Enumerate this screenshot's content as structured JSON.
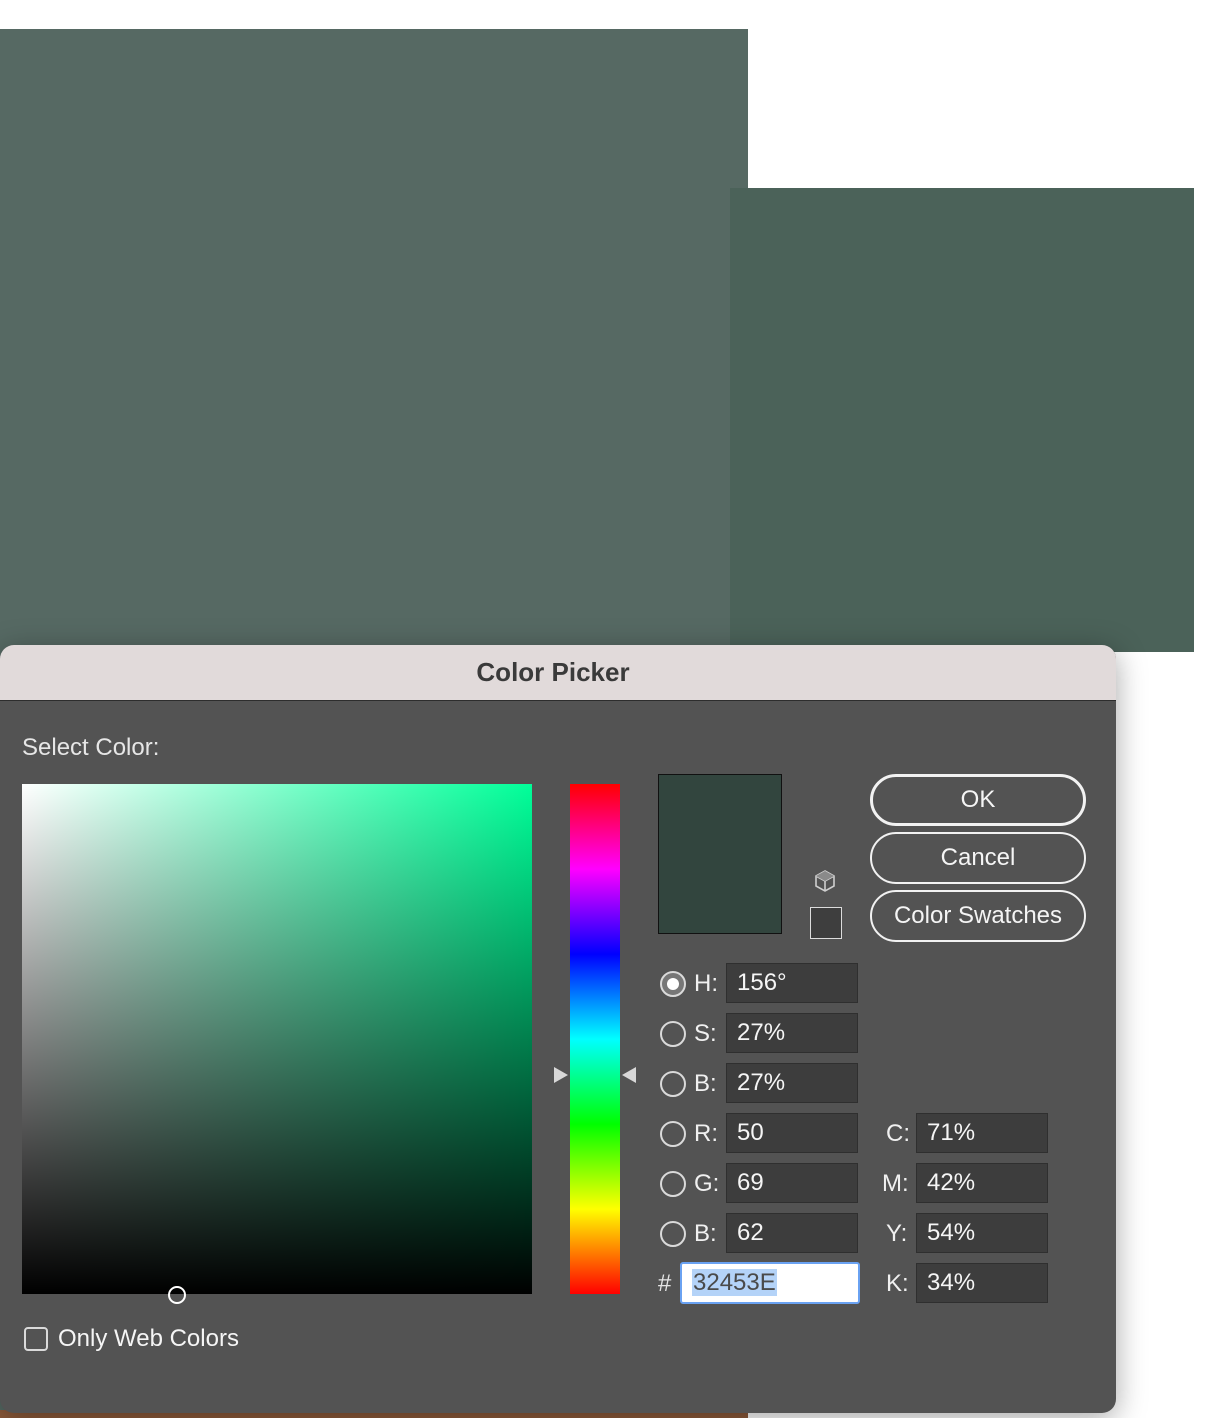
{
  "canvas": {
    "swatch_colors": [
      "#566963",
      "#4b6259",
      "#8c5a3a"
    ]
  },
  "dialog": {
    "title": "Color Picker",
    "select_color_label": "Select Color:",
    "buttons": {
      "ok": "OK",
      "cancel": "Cancel",
      "color_swatches": "Color Swatches"
    },
    "current_color": "#32453E",
    "hsb": [
      {
        "label": "H:",
        "value": "156°",
        "selected": true
      },
      {
        "label": "S:",
        "value": "27%",
        "selected": false
      },
      {
        "label": "B:",
        "value": "27%",
        "selected": false
      }
    ],
    "rgb": [
      {
        "label": "R:",
        "value": "50",
        "selected": false
      },
      {
        "label": "G:",
        "value": "69",
        "selected": false
      },
      {
        "label": "B:",
        "value": "62",
        "selected": false
      }
    ],
    "cmyk": [
      {
        "label": "C:",
        "value": "71%"
      },
      {
        "label": "M:",
        "value": "42%"
      },
      {
        "label": "Y:",
        "value": "54%"
      },
      {
        "label": "K:",
        "value": "34%"
      }
    ],
    "hex": {
      "prefix": "#",
      "value": "32453E"
    },
    "only_web_colors": {
      "label": "Only Web Colors",
      "checked": false
    },
    "icons": {
      "gamut_warning": "cube-icon",
      "web_safe_swatch": "web-safe-swatch"
    }
  }
}
